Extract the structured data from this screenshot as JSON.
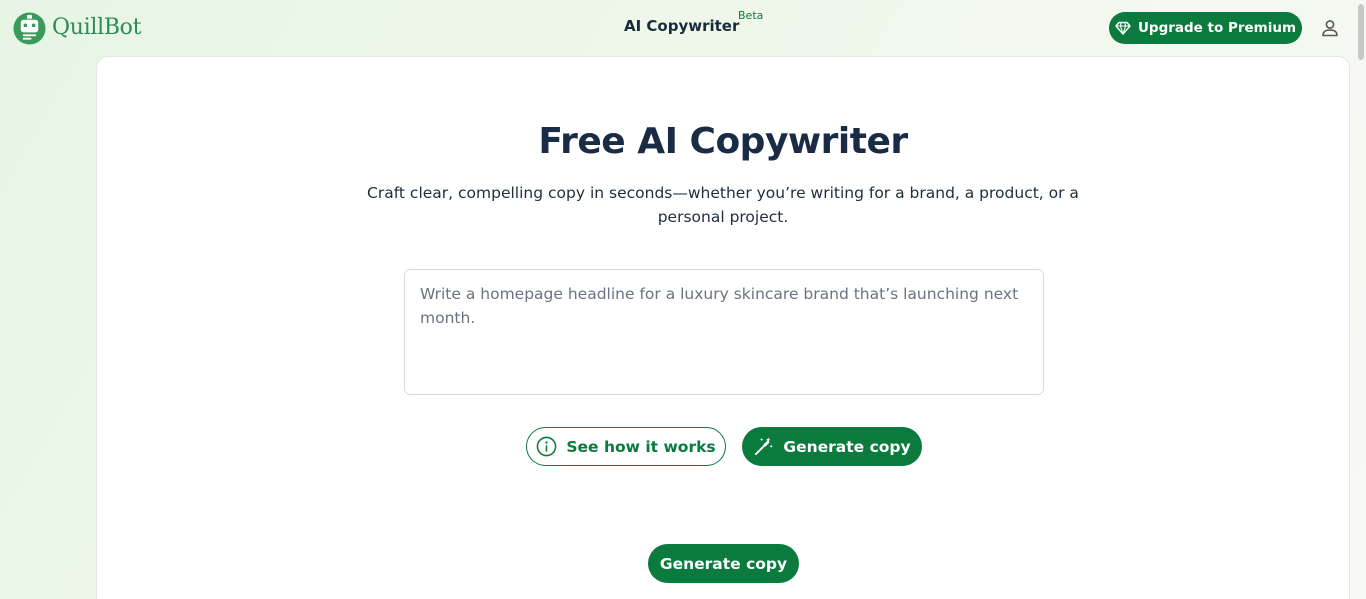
{
  "header": {
    "logo_text": "QuillBot",
    "app_title": "AI Copywriter",
    "beta_badge": "Beta",
    "upgrade_label": "Upgrade to Premium"
  },
  "main": {
    "title": "Free AI Copywriter",
    "subtitle": "Craft clear, compelling copy in seconds—whether you’re writing for a brand, a product, or a personal project.",
    "prompt": {
      "value": "",
      "placeholder": "Write a homepage headline for a luxury skincare brand that’s launching next month."
    },
    "see_how_label": "See how it works",
    "generate_label": "Generate copy",
    "generate_secondary_label": "Generate copy"
  },
  "icons": {
    "logo": "quillbot-robot-icon",
    "upgrade": "diamond-icon",
    "account": "user-icon",
    "info": "info-icon",
    "generate": "magic-wand-icon"
  },
  "colors": {
    "brand_green": "#0a7a3d",
    "logo_green": "#2e8b57",
    "title_navy": "#1a2b45"
  }
}
